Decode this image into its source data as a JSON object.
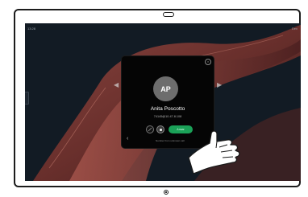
{
  "status": {
    "time": "13:28",
    "right": "Dev"
  },
  "call": {
    "initials": "AP",
    "name": "Anita Poscotto",
    "address": "74145@10.47.8.108",
    "answer_label": "Ansar",
    "footnote": "Number from unknown call"
  },
  "icons": {
    "mute": "mute-icon",
    "video": "video-icon",
    "back": "chevron-left-icon",
    "close": "close-icon"
  },
  "colors": {
    "screen": "#121b24",
    "answer": "#1ba158",
    "wallpaper": "#7a3b35"
  }
}
